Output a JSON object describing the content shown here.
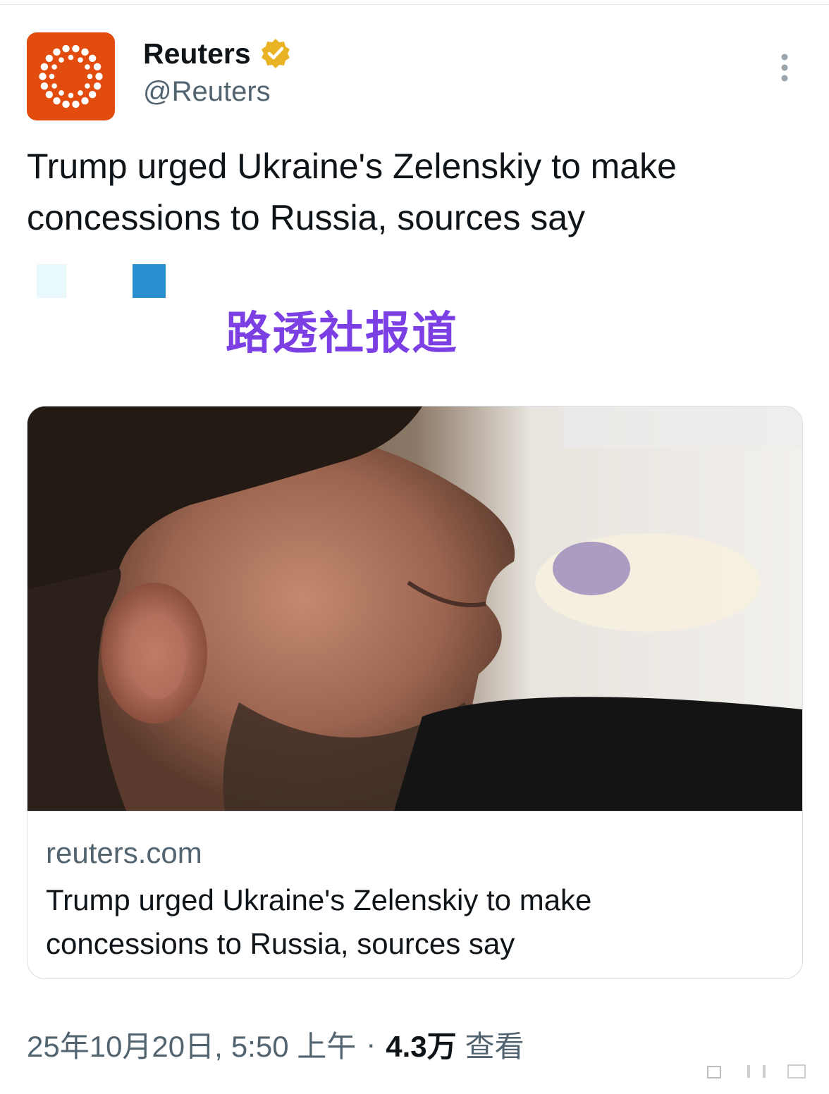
{
  "colors": {
    "brand": "#e24d0f",
    "accent": "#7b3fe4",
    "verified": "#e9b325"
  },
  "author": {
    "display_name": "Reuters",
    "handle": "@Reuters",
    "verified": true,
    "avatar_icon": "reuters-logo-icon"
  },
  "post": {
    "text_line1": "Trump urged Ukraine's Zelenskiy to make",
    "text_line2": "concessions to Russia, sources say"
  },
  "overlay": {
    "stamp_text": "路透社报道"
  },
  "card": {
    "image_icon": "article-photo",
    "domain": "reuters.com",
    "title_line1": "Trump urged Ukraine's Zelenskiy to make",
    "title_line2": "concessions to Russia, sources say"
  },
  "meta": {
    "date": "25年10月20日,",
    "time": "5:50 上午",
    "separator": "·",
    "views_count": "4.3万",
    "views_label": "查看"
  },
  "icons": {
    "more": "more-vertical-icon",
    "verified": "verified-badge-icon"
  }
}
